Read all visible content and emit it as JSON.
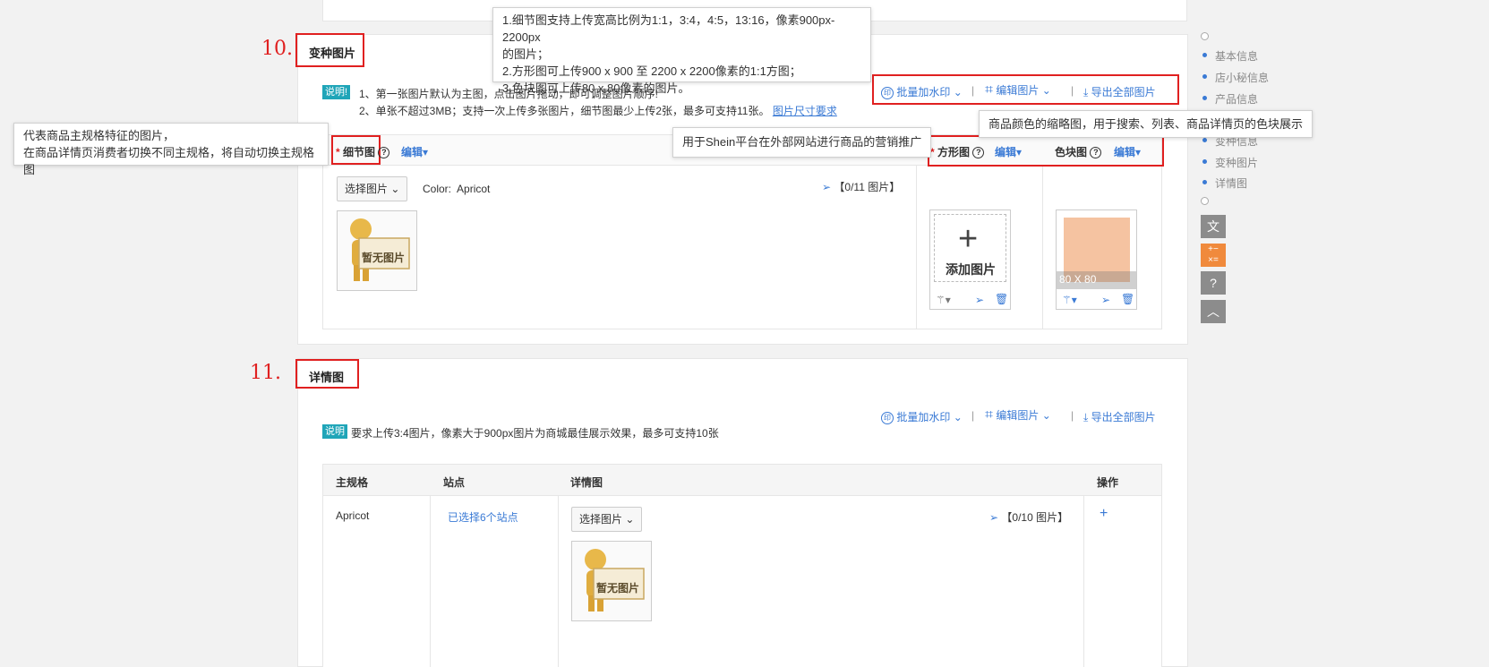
{
  "top_tooltip": {
    "lines": [
      "1.细节图支持上传宽高比例为1:1，3:4，4:5，13:16，像素900px-2200px",
      "的图片；",
      "2.方形图可上传900 x 900 至 2200 x 2200像素的1:1方图；",
      "3.色块图可上传80 x 80像素的图片。"
    ]
  },
  "left_tooltip": {
    "lines": [
      "代表商品主规格特征的图片，",
      "在商品详情页消费者切换不同主规格，将自动切换主规格图"
    ]
  },
  "marketing_tooltip": "用于Shein平台在外部网站进行商品的营销推广",
  "swatch_tooltip": "商品颜色的缩略图，用于搜索、列表、商品详情页的色块展示",
  "variant_section": {
    "marker": "10.",
    "title": "变种图片",
    "note_badge": "说明!",
    "note_line1": "1、第一张图片默认为主图，点击图片拖动，即可调整图片顺序!",
    "note_line2": "2、单张不超过3MB；支持一次上传多张图片，细节图最少上传2张，最多可支持11张。",
    "size_link": "图片尺寸要求",
    "toolbar": {
      "watermark": "批量加水印",
      "edit_images": "编辑图片",
      "export_all": "导出全部图片"
    },
    "detail_label": "细节图",
    "edit_label": "编辑",
    "square_label": "方形图",
    "swatch_label": "色块图",
    "select_button": "选择图片",
    "color_text": "Color:  Apricot",
    "count": "【0/11 图片】",
    "no_image": "暂无图片",
    "add_image": "添加图片",
    "swatch_size": "80 X 80",
    "swatch_color": "#f5c3a1"
  },
  "detail_section": {
    "marker": "11.",
    "title": "详情图",
    "note_badge": "说明",
    "note_text": "要求上传3:4图片，像素大于900px图片为商城最佳展示效果，最多可支持10张",
    "toolbar": {
      "watermark": "批量加水印",
      "edit_images": "编辑图片",
      "export_all": "导出全部图片"
    },
    "table": {
      "headers": [
        "主规格",
        "站点",
        "详情图",
        "操作"
      ],
      "row": {
        "main_spec": "Apricot",
        "sites": "已选择6个站点",
        "select_button": "选择图片",
        "count": "【0/10 图片】",
        "no_image": "暂无图片",
        "add": "+"
      }
    }
  },
  "side_nav": {
    "items": [
      "基本信息",
      "店小秘信息",
      "产品信息",
      "变种信息",
      "变种图片",
      "详情图"
    ]
  },
  "colors": {
    "accent": "#3a7ad5",
    "highlight_red": "#e02020",
    "badge_teal": "#1fa5b8"
  }
}
